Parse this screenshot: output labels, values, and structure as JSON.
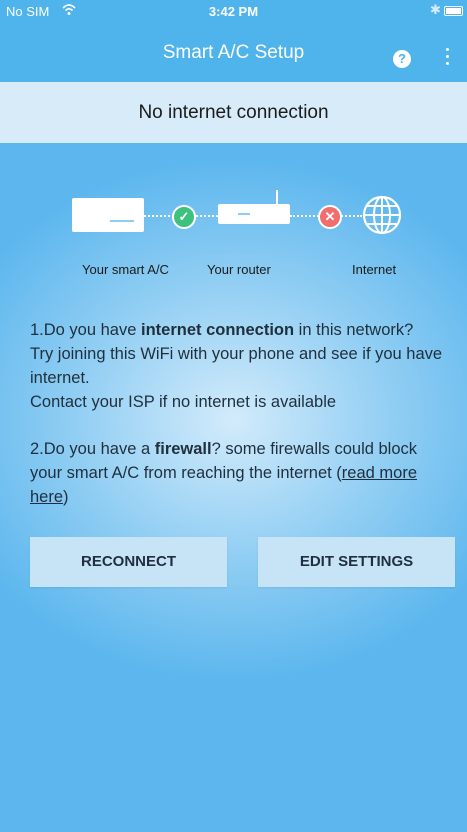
{
  "statusbar": {
    "carrier": "No SIM",
    "time": "3:42 PM",
    "bluetooth_icon": "bluetooth-icon"
  },
  "appbar": {
    "title": "Smart A/C Setup",
    "help_label": "?",
    "help_icon": "help-icon",
    "more_icon": "more-vertical-icon"
  },
  "banner": {
    "text": "No internet connection"
  },
  "diagram": {
    "labels": {
      "ac": "Your smart A/C",
      "router": "Your router",
      "internet": "Internet"
    },
    "ac_router_status": "ok",
    "router_internet_status": "error",
    "ok_symbol": "✓",
    "error_symbol": "✕",
    "colors": {
      "ok": "#3ec17d",
      "error": "#f06e6e"
    }
  },
  "tips": {
    "tip1": {
      "prefix": "1.Do you have ",
      "bold": "internet connection",
      "suffix": " in this network?",
      "line2": "Try joining this WiFi with your phone and see if you have internet.",
      "line3": "Contact your ISP if no internet is available"
    },
    "tip2": {
      "prefix": "2.Do you have a ",
      "bold": "firewall",
      "middle": "? some firewalls could block your smart A/C from reaching the internet (",
      "link": "read more here",
      "suffix": ")"
    }
  },
  "buttons": {
    "reconnect": "RECONNECT",
    "edit_settings": "EDIT SETTINGS"
  },
  "colors": {
    "primary": "#4fb3ec",
    "banner_bg": "#d7ebf8",
    "button_bg": "#c7e4f6"
  }
}
